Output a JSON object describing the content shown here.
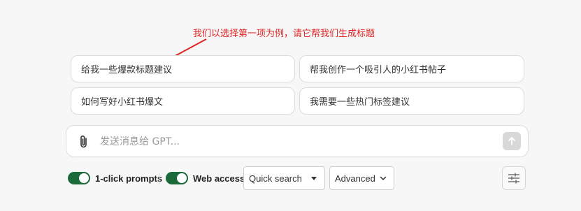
{
  "annotation": {
    "text": "我们以选择第一项为例，请它帮我们生成标题",
    "color": "#e02424"
  },
  "suggestions": [
    {
      "label": "给我一些爆款标题建议"
    },
    {
      "label": "帮我创作一个吸引人的小红书帖子"
    },
    {
      "label": "如何写好小红书爆文"
    },
    {
      "label": "我需要一些热门标签建议"
    }
  ],
  "composer": {
    "placeholder": "发送消息给 GPT...",
    "value": "",
    "attach_icon": "paperclip-icon",
    "send_icon": "arrow-up-icon"
  },
  "toolbar": {
    "one_click_prompts": {
      "label": "1-click prompts",
      "enabled": true
    },
    "web_access": {
      "label": "Web access",
      "enabled": true
    },
    "search_mode": {
      "selected": "Quick search",
      "icon": "caret-down-icon"
    },
    "advanced": {
      "selected": "Advanced",
      "icon": "chevron-down-icon"
    },
    "settings_icon": "sliders-icon"
  },
  "colors": {
    "toggle_on": "#1b6b3a",
    "background": "#f7f7f7"
  }
}
